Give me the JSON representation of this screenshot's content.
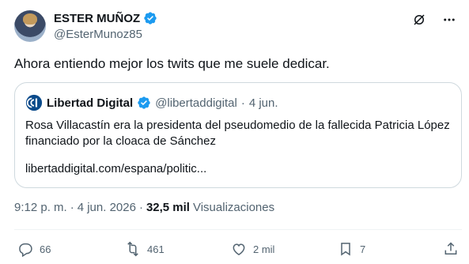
{
  "author": {
    "display_name": "ESTER MUÑOZ",
    "handle": "@EsterMunoz85"
  },
  "tweet": {
    "text": "Ahora entiendo mejor los twits que me suele dedicar."
  },
  "quote": {
    "display_name": "Libertad Digital",
    "handle": "@libertaddigital",
    "separator": "·",
    "date": "4 jun.",
    "text": "Rosa Villacastín era la presidenta del pseudomedio de la fallecida Patricia López financiado por la cloaca de Sánchez",
    "link": "libertaddigital.com/espana/politic..."
  },
  "meta": {
    "time": "9:12 p. m.",
    "sep1": "·",
    "date": "4 jun. 2026",
    "sep2": "·",
    "views_count": "32,5 mil",
    "views_label": "Visualizaciones"
  },
  "actions": {
    "replies": "66",
    "reposts": "461",
    "likes": "2 mil",
    "bookmarks": "7"
  },
  "colors": {
    "verified": "#1d9bf0",
    "secondary_text": "#536471",
    "border": "#cfd9de",
    "libertad_logo": "#0a4a8a"
  },
  "icons": [
    "grok-icon",
    "more-icon",
    "reply-icon",
    "repost-icon",
    "like-icon",
    "bookmark-icon",
    "share-icon",
    "verified-icon"
  ]
}
